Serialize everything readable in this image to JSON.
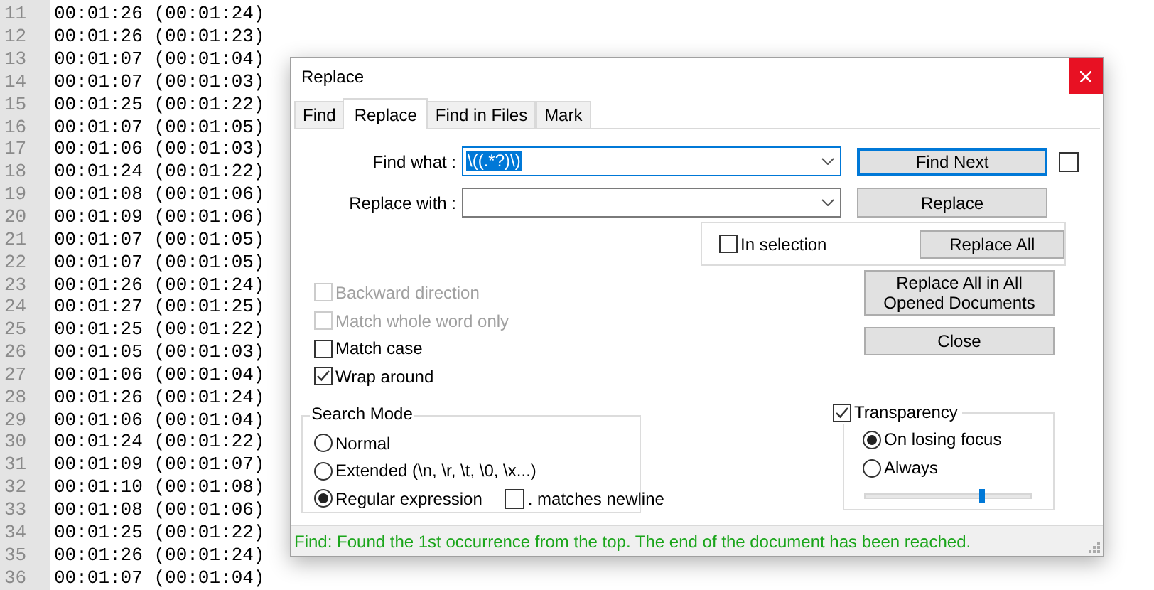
{
  "editor": {
    "lines": [
      {
        "number": "11",
        "text": "00:01:26 (00:01:24)"
      },
      {
        "number": "12",
        "text": "00:01:26 (00:01:23)"
      },
      {
        "number": "13",
        "text": "00:01:07 (00:01:04)"
      },
      {
        "number": "14",
        "text": "00:01:07 (00:01:03)"
      },
      {
        "number": "15",
        "text": "00:01:25 (00:01:22)"
      },
      {
        "number": "16",
        "text": "00:01:07 (00:01:05)"
      },
      {
        "number": "17",
        "text": "00:01:06 (00:01:03)"
      },
      {
        "number": "18",
        "text": "00:01:24 (00:01:22)"
      },
      {
        "number": "19",
        "text": "00:01:08 (00:01:06)"
      },
      {
        "number": "20",
        "text": "00:01:09 (00:01:06)"
      },
      {
        "number": "21",
        "text": "00:01:07 (00:01:05)"
      },
      {
        "number": "22",
        "text": "00:01:07 (00:01:05)"
      },
      {
        "number": "23",
        "text": "00:01:26 (00:01:24)"
      },
      {
        "number": "24",
        "text": "00:01:27 (00:01:25)"
      },
      {
        "number": "25",
        "text": "00:01:25 (00:01:22)"
      },
      {
        "number": "26",
        "text": "00:01:05 (00:01:03)"
      },
      {
        "number": "27",
        "text": "00:01:06 (00:01:04)"
      },
      {
        "number": "28",
        "text": "00:01:26 (00:01:24)"
      },
      {
        "number": "29",
        "text": "00:01:06 (00:01:04)"
      },
      {
        "number": "30",
        "text": "00:01:24 (00:01:22)"
      },
      {
        "number": "31",
        "text": "00:01:09 (00:01:07)"
      },
      {
        "number": "32",
        "text": "00:01:10 (00:01:08)"
      },
      {
        "number": "33",
        "text": "00:01:08 (00:01:06)"
      },
      {
        "number": "34",
        "text": "00:01:25 (00:01:22)"
      },
      {
        "number": "35",
        "text": "00:01:26 (00:01:24)"
      },
      {
        "number": "36",
        "text": "00:01:07 (00:01:04)"
      }
    ]
  },
  "dialog": {
    "title": "Replace",
    "tabs": [
      {
        "label": "Find",
        "selected": false
      },
      {
        "label": "Replace",
        "selected": true
      },
      {
        "label": "Find in Files",
        "selected": false
      },
      {
        "label": "Mark",
        "selected": false
      }
    ],
    "find_what": {
      "label": "Find what :",
      "value": "\\((.*?)\\)"
    },
    "replace_with": {
      "label": "Replace with :"
    },
    "find_next_button": "Find Next",
    "find_next_checkbox": {
      "checked": false
    },
    "replace_button": "Replace",
    "in_selection": {
      "label": "In selection",
      "checked": false
    },
    "replace_all_button": "Replace All",
    "replace_all_opened_button": "Replace All in All Opened Documents",
    "close_button": "Close",
    "options": [
      {
        "label": "Backward direction",
        "checked": false,
        "disabled": true
      },
      {
        "label": "Match whole word only",
        "checked": false,
        "disabled": true
      },
      {
        "label": "Match case",
        "checked": false,
        "disabled": false
      },
      {
        "label": "Wrap around",
        "checked": true,
        "disabled": false
      }
    ],
    "search_mode": {
      "title": "Search Mode",
      "modes": [
        {
          "label": "Normal",
          "selected": false
        },
        {
          "label": "Extended (\\n, \\r, \\t, \\0, \\x...)",
          "selected": false
        },
        {
          "label": "Regular expression",
          "selected": true
        }
      ],
      "dot_matches_newline": {
        "label": ". matches newline",
        "checked": false
      }
    },
    "transparency": {
      "label": "Transparency",
      "checked": true,
      "options": [
        {
          "label": "On losing focus",
          "selected": true
        },
        {
          "label": "Always",
          "selected": false
        }
      ],
      "slider": {
        "level": 0.71
      }
    },
    "status": "Find: Found the 1st occurrence from the top. The end of the document has been reached."
  }
}
